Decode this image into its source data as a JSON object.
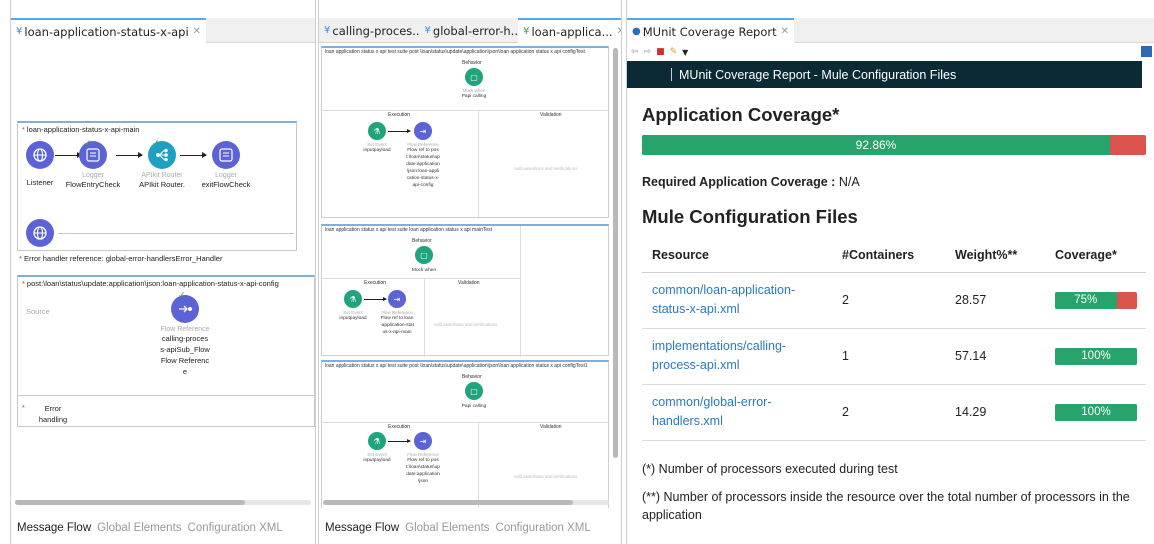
{
  "left_editor": {
    "tab": {
      "label": "loan-application-status-x-api"
    },
    "main_flow": {
      "title": "loan-application-status-x-api-main",
      "nodes": [
        {
          "type": "",
          "label": "Listener"
        },
        {
          "type": "Logger",
          "label": "FlowEntryCheck"
        },
        {
          "type": "APIkit Router",
          "label": "APIkit Router."
        },
        {
          "type": "Logger",
          "label": "exitFlowCheck"
        }
      ],
      "error_ref": "Error handler reference: global-error-handlersError_Handler"
    },
    "config_flow": {
      "title": "post:\\loan\\status\\update:application\\json:loan-application-status-x-api-config",
      "source_label": "Source",
      "node": {
        "type": "Flow Reference",
        "label": "calling-process-apiSub_FlowFlow Reference"
      },
      "error_handling": "Error handling"
    },
    "bottom_tabs": [
      "Message Flow",
      "Global Elements",
      "Configuration XML"
    ]
  },
  "mid_editor": {
    "tabs": [
      {
        "label": "calling-proces..."
      },
      {
        "label": "global-error-h..."
      },
      {
        "label": "loan-applica..."
      }
    ],
    "suites": [
      {
        "title": "loan application status x api test suite post \\loan\\status\\update\\application\\json\\loan application status x api configTest",
        "behavior": "Behavior",
        "behavior_node": {
          "type": "Mock when",
          "label": "Papi calling"
        },
        "execution": "Execution",
        "validation": "Validation",
        "exec_nodes": [
          {
            "type": "Set Event",
            "label": "inputpayload"
          },
          {
            "type": "Flow Reference",
            "label": "Flow ref to post:\\loan\\status\\update:application\\json:loan-application-status-x-api-config"
          }
        ],
        "add_text": "Add assertions and verifications"
      },
      {
        "title": "loan application status x api test suite loan application status x api mainTest",
        "behavior": "Behavior",
        "behavior_node": {
          "type": "",
          "label": "Mock when"
        },
        "execution": "Execution",
        "validation": "Validation",
        "exec_nodes": [
          {
            "type": "Set Event",
            "label": "inputpayload"
          },
          {
            "type": "Flow Reference",
            "label": "Flow ref to loan-application-status-x-api-main"
          }
        ],
        "add_text": "Add assertions and verifications"
      },
      {
        "title": "loan application status x api test suite post \\loan\\status\\update\\application\\json\\loan application status x api configTest1",
        "behavior": "Behavior",
        "behavior_node": {
          "type": "",
          "label": "Papi calling"
        },
        "execution": "Execution",
        "validation": "Validation",
        "exec_nodes": [
          {
            "type": "Set Event",
            "label": "inputpayload"
          },
          {
            "type": "Flow Reference",
            "label": "Flow ref to post:\\loan\\status\\update:application\\json"
          }
        ],
        "add_text": "Add assertions and verifications"
      }
    ],
    "bottom_tabs": [
      "Message Flow",
      "Global Elements",
      "Configuration XML"
    ]
  },
  "report": {
    "tab": {
      "label": "MUnit Coverage Report"
    },
    "header": "MUnit Coverage Report - Mule Configuration Files",
    "app_coverage": {
      "title": "Application Coverage*",
      "value": 92.86,
      "label": "92.86%"
    },
    "required": {
      "label": "Required Application Coverage :",
      "value": "N/A"
    },
    "files_title": "Mule Configuration Files",
    "columns": [
      "Resource",
      "#Containers",
      "Weight%**",
      "Coverage*"
    ],
    "rows": [
      {
        "resource": "common/loan-application-status-x-api.xml",
        "containers": "2",
        "weight": "28.57",
        "coverage": 75,
        "coverage_label": "75%"
      },
      {
        "resource": "implementations/calling-process-api.xml",
        "containers": "1",
        "weight": "57.14",
        "coverage": 100,
        "coverage_label": "100%"
      },
      {
        "resource": "common/global-error-handlers.xml",
        "containers": "2",
        "weight": "14.29",
        "coverage": 100,
        "coverage_label": "100%"
      }
    ],
    "note1": "(*) Number of processors executed during test",
    "note2": "(**) Number of processors inside the resource over the total number of processors in the application"
  },
  "colors": {
    "covered": "#26a46b",
    "uncovered": "#dc534d",
    "header_bg": "#0b2a36",
    "link": "#2a7ac0"
  },
  "icons": {
    "listener": "globe-icon",
    "logger": "logger-icon",
    "router": "router-icon",
    "flowref": "flow-reference-icon",
    "mock": "mock-icon",
    "set_event": "set-event-icon"
  }
}
